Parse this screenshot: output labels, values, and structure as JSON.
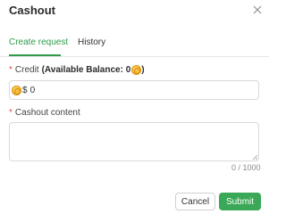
{
  "dialog": {
    "title": "Cashout",
    "close_icon": "close-icon"
  },
  "tabs": [
    {
      "label": "Create request",
      "active": true
    },
    {
      "label": "History",
      "active": false
    }
  ],
  "credit": {
    "required_mark": "*",
    "label": "Credit",
    "available_balance_text": "(Available Balance: 0",
    "available_balance_close": ")",
    "currency_prefix": "$",
    "value": "0",
    "coin_icon": "coin-icon"
  },
  "cashout_content": {
    "required_mark": "*",
    "label": "Cashout content",
    "value": "",
    "char_count": "0 / 1000"
  },
  "footer": {
    "cancel_label": "Cancel",
    "submit_label": "Submit"
  },
  "colors": {
    "accent": "#2e9a4a",
    "submit_bg": "#3aa856",
    "required": "#e5484d",
    "coin": "#f0a820"
  }
}
